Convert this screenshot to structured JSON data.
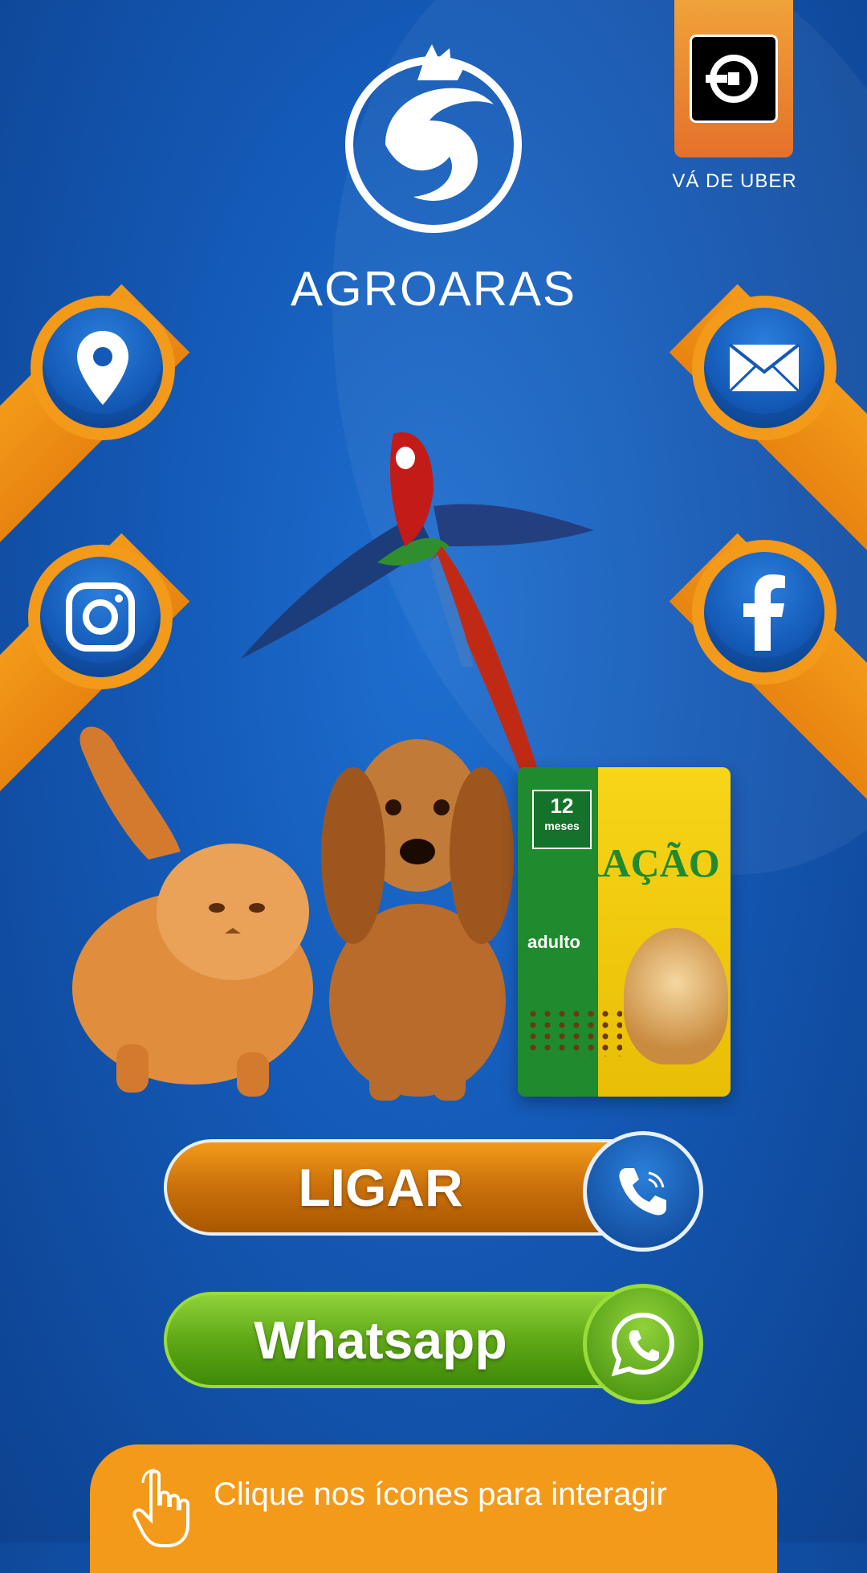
{
  "brand": {
    "name": "AGROARAS"
  },
  "uber": {
    "label": "VÁ DE UBER"
  },
  "social": {
    "location": "location-pin-icon",
    "instagram": "instagram-icon",
    "email": "mail-icon",
    "facebook": "facebook-icon"
  },
  "product": {
    "title": "RAÇÃO",
    "badge_number": "12",
    "badge_unit": "meses",
    "subtitle": "adulto"
  },
  "buttons": {
    "ligar": "LIGAR",
    "whatsapp": "Whatsapp"
  },
  "footer": {
    "hint": "Clique nos ícones para interagir"
  },
  "colors": {
    "background": "#1459b6",
    "accent_orange": "#f39a1a",
    "whatsapp_green": "#5fa816",
    "white": "#ffffff"
  }
}
